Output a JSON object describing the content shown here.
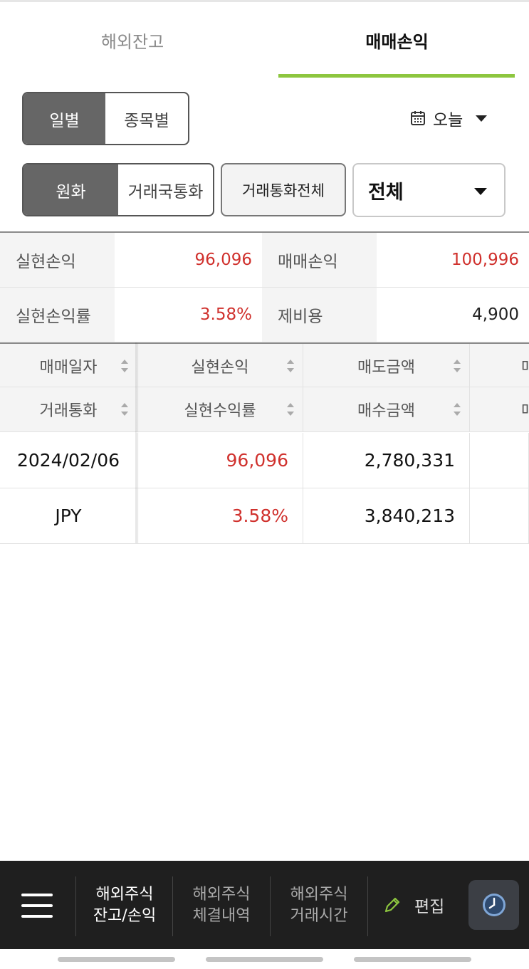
{
  "tabs": [
    {
      "label": "해외잔고"
    },
    {
      "label": "매매손익"
    }
  ],
  "period_toggle": {
    "options": [
      "일별",
      "종목별"
    ],
    "selected": "일별"
  },
  "date_filter": {
    "label": "오늘",
    "icon": "calendar-icon"
  },
  "currency_toggle": {
    "options": [
      "원화",
      "거래국통화"
    ],
    "selected": "원화"
  },
  "currency_all_button": "거래통화전체",
  "category_select": {
    "value": "전체"
  },
  "summary": {
    "realized_pl_label": "실현손익",
    "realized_pl_value": "96,096",
    "trade_pl_label": "매매손익",
    "trade_pl_value": "100,996",
    "realized_rate_label": "실현손익률",
    "realized_rate_value": "3.58%",
    "fees_label": "제비용",
    "fees_value": "4,900"
  },
  "table": {
    "header_row1": [
      "매매일자",
      "실현손익",
      "매도금액",
      "매"
    ],
    "header_row2": [
      "거래통화",
      "실현수익률",
      "매수금액",
      "매"
    ],
    "rows": [
      [
        "2024/02/06",
        "96,096",
        "2,780,331"
      ],
      [
        "JPY",
        "3.58%",
        "3,840,213"
      ]
    ]
  },
  "bottom_nav": {
    "items": [
      {
        "line1": "해외주식",
        "line2": "잔고/손익"
      },
      {
        "line1": "해외주식",
        "line2": "체결내역"
      },
      {
        "line1": "해외주식",
        "line2": "거래시간"
      }
    ],
    "edit_label": "편집"
  },
  "colors": {
    "accent_green": "#8dc63f",
    "profit_red": "#d0312d",
    "nav_bg": "#1f1f1f"
  }
}
